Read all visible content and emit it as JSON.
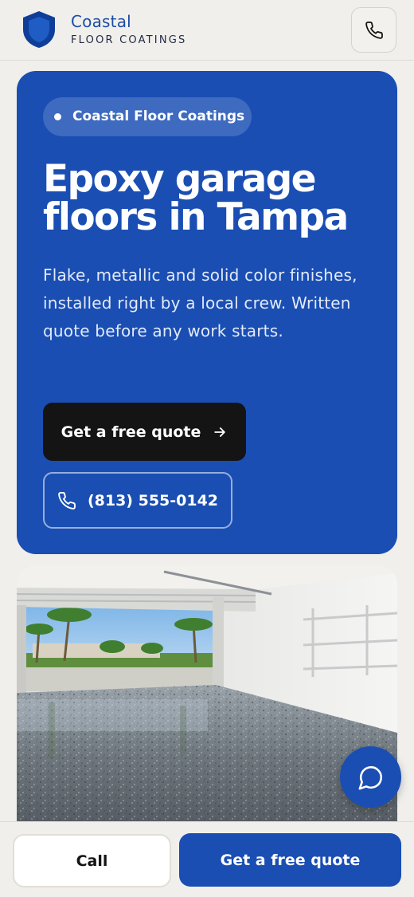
{
  "header": {
    "brand_name": "Coastal",
    "brand_sub": "FLOOR COATINGS",
    "logo_icon": "shield-logo",
    "call_icon": "phone-icon"
  },
  "hero": {
    "pill_text": "Coastal Floor Coatings",
    "title": "Epoxy garage floors in Tampa",
    "description": "Flake, metallic and solid color finishes, installed right by a local crew. Written quote before any work starts.",
    "primary_button": "Get a free quote",
    "primary_button_icon": "arrow-right-icon",
    "phone_button": "(813) 555-0142",
    "phone_button_icon": "phone-icon"
  },
  "photo": {
    "subject": "garage-photo"
  },
  "chat": {
    "icon": "chat-bubble-icon"
  },
  "bottom_bar": {
    "call_label": "Call",
    "quote_label": "Get a free quote"
  },
  "colors": {
    "brand_blue": "#1a4eb3",
    "dark": "#141414",
    "background": "#f1efeb"
  }
}
